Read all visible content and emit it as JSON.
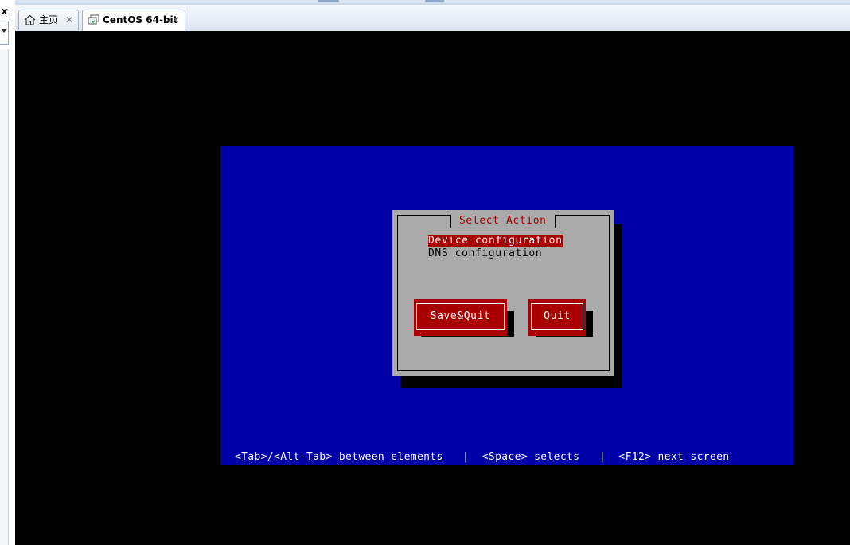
{
  "host": {
    "close_glyph": "x",
    "tabs": [
      {
        "label": "主页",
        "icon": "home-icon",
        "close": "✕",
        "active": false
      },
      {
        "label": "CentOS 64-bit",
        "icon": "vm-icon",
        "close": "✕",
        "active": true
      }
    ]
  },
  "dialog": {
    "title": "Select Action",
    "items": [
      {
        "label": "Device configuration",
        "selected": true
      },
      {
        "label": "DNS configuration",
        "selected": false
      }
    ],
    "buttons": {
      "save_quit": "Save&Quit",
      "quit": "Quit"
    }
  },
  "helpline": "<Tab>/<Alt-Tab> between elements   |  <Space> selects   |  <F12> next screen",
  "colors": {
    "tui_background": "#0000a8",
    "dialog_background": "#aaaaaa",
    "accent_red": "#a80000",
    "vm_background": "#000000"
  }
}
